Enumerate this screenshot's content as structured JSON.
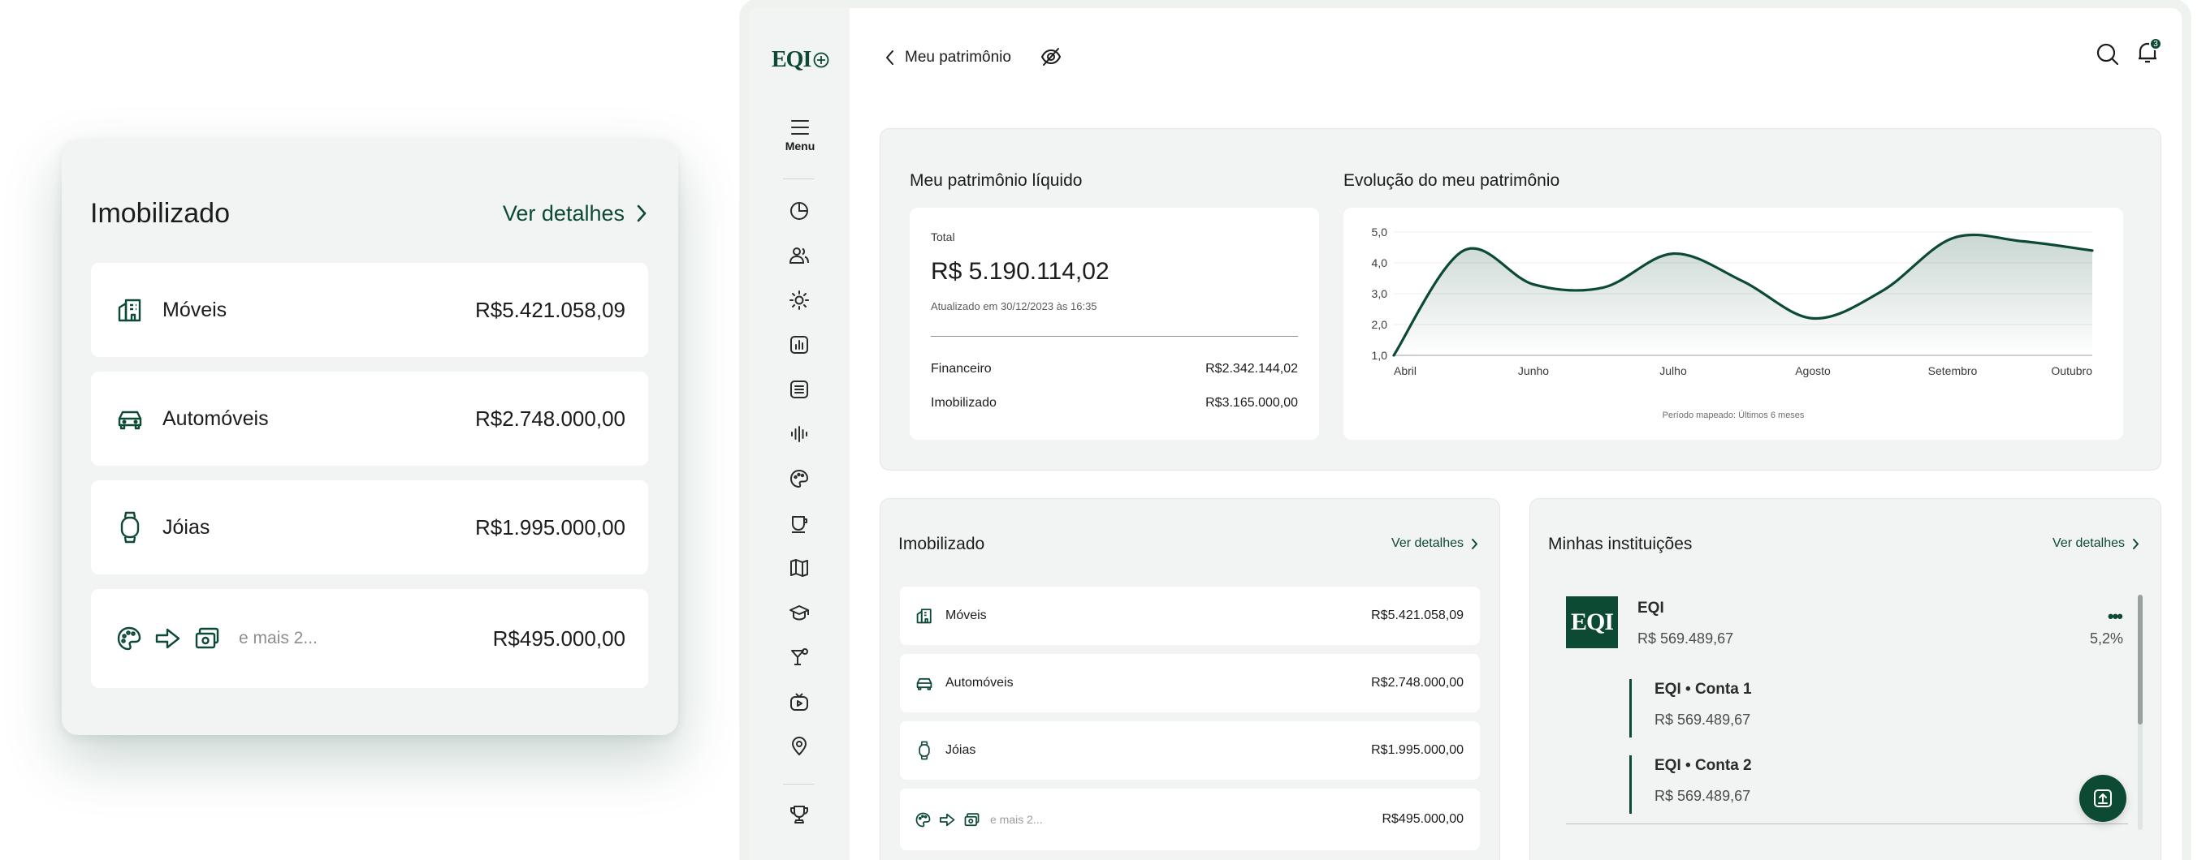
{
  "zoom_card": {
    "title": "Imobilizado",
    "link_label": "Ver detalhes",
    "items": [
      {
        "label": "Móveis",
        "value": "R$5.421.058,09"
      },
      {
        "label": "Automóveis",
        "value": "R$2.748.000,00"
      },
      {
        "label": "Jóias",
        "value": "R$1.995.000,00"
      }
    ],
    "more_label": "e mais 2...",
    "more_value": "R$495.000,00"
  },
  "app": {
    "logo": "EQI",
    "menu_label": "Menu",
    "header": {
      "back_label": "Meu patrimônio",
      "notification_count": "3"
    },
    "net_worth": {
      "title": "Meu patrimônio líquido",
      "total_label": "Total",
      "total_value": "R$ 5.190.114,02",
      "updated": "Atualizado em 30/12/2023 às 16:35",
      "rows": [
        {
          "label": "Financeiro",
          "value": "R$2.342.144,02"
        },
        {
          "label": "Imobilizado",
          "value": "R$3.165.000,00"
        }
      ]
    },
    "evolution": {
      "title": "Evolução do meu patrimônio",
      "footnote": "Período mapeado: Últimos 6 meses"
    },
    "imobilizado": {
      "title": "Imobilizado",
      "link_label": "Ver detalhes",
      "items": [
        {
          "label": "Móveis",
          "value": "R$5.421.058,09"
        },
        {
          "label": "Automóveis",
          "value": "R$2.748.000,00"
        },
        {
          "label": "Jóias",
          "value": "R$1.995.000,00"
        }
      ],
      "more_label": "e mais 2...",
      "more_value": "R$495.000,00"
    },
    "institutions": {
      "title": "Minhas instituições",
      "link_label": "Ver detalhes",
      "logo": "EQI",
      "name": "EQI",
      "value": "R$ 569.489,67",
      "percent": "5,2%",
      "accounts": [
        {
          "name": "EQI • Conta 1",
          "value": "R$ 569.489,67"
        },
        {
          "name": "EQI • Conta 2",
          "value": "R$ 569.489,67"
        }
      ]
    }
  },
  "chart_data": {
    "type": "area",
    "categories": [
      "Abril",
      "Junho",
      "Julho",
      "Agosto",
      "Setembro",
      "Outubro"
    ],
    "x": [
      0,
      1,
      2,
      3,
      4,
      5,
      6,
      7,
      8,
      9,
      10
    ],
    "values": [
      1.0,
      4.4,
      3.3,
      3.2,
      4.3,
      3.4,
      2.2,
      3.1,
      4.8,
      4.7,
      4.4
    ],
    "ylim": [
      1.0,
      5.0
    ],
    "yticks": [
      "1,0",
      "2,0",
      "3,0",
      "4,0",
      "5,0"
    ],
    "grid": true,
    "line_color": "#0d4a33"
  }
}
